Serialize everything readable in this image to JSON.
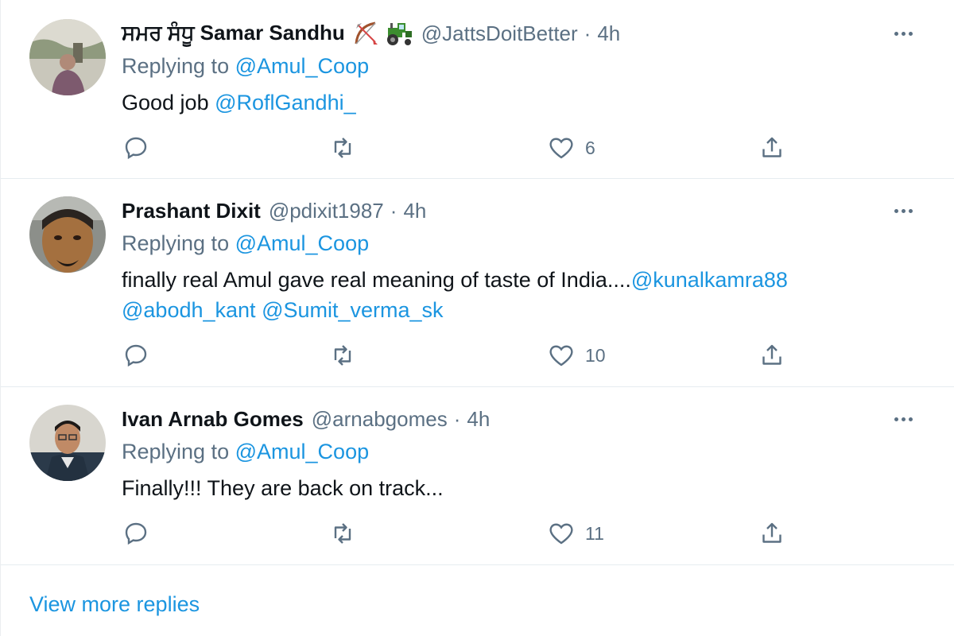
{
  "tweets": [
    {
      "display_name": "ਸਮਰ ਸੰਧੂ Samar Sandhu",
      "emojis": [
        "bow-and-arrow-emoji",
        "tractor-emoji"
      ],
      "handle": "@JattsDoitBetter",
      "separator": "·",
      "time": "4h",
      "replying_prefix": "Replying to",
      "replying_to": "@Amul_Coop",
      "text_parts": [
        {
          "text": "Good job ",
          "mention": false
        },
        {
          "text": "@RoflGandhi_",
          "mention": true
        }
      ],
      "reply_count": "",
      "retweet_count": "",
      "like_count": "6"
    },
    {
      "display_name": "Prashant Dixit",
      "emojis": [],
      "handle": "@pdixit1987",
      "separator": "·",
      "time": "4h",
      "replying_prefix": "Replying to",
      "replying_to": "@Amul_Coop",
      "text_parts": [
        {
          "text": "finally real Amul gave real meaning of taste of India....",
          "mention": false
        },
        {
          "text": "@kunalkamra88",
          "mention": true
        },
        {
          "text": "@abodh_kant",
          "mention": true
        },
        {
          "text": " ",
          "mention": false
        },
        {
          "text": "@Sumit_verma_sk",
          "mention": true
        }
      ],
      "reply_count": "",
      "retweet_count": "",
      "like_count": "10"
    },
    {
      "display_name": "Ivan Arnab Gomes",
      "emojis": [],
      "handle": "@arnabgomes",
      "separator": "·",
      "time": "4h",
      "replying_prefix": "Replying to",
      "replying_to": "@Amul_Coop",
      "text_parts": [
        {
          "text": "Finally!!! They are back on track...",
          "mention": false
        }
      ],
      "reply_count": "",
      "retweet_count": "",
      "like_count": "11"
    }
  ],
  "view_more_label": "View more replies",
  "colors": {
    "accent": "#1b95e0",
    "secondary_text": "#5b7083",
    "primary_text": "#0f1419",
    "divider": "#e6ecf0"
  }
}
